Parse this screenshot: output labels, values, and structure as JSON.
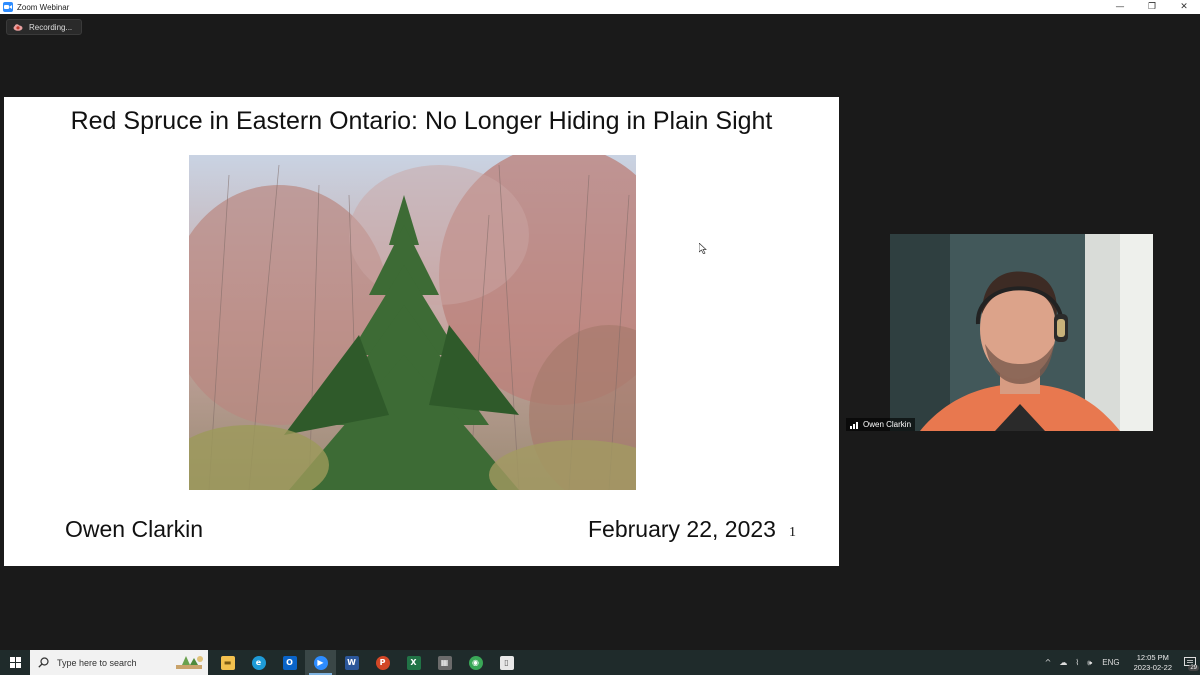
{
  "window": {
    "title": "Zoom Webinar",
    "controls": {
      "minimize": "—",
      "restore": "❐",
      "close": "✕"
    }
  },
  "recording": {
    "label": "Recording..."
  },
  "slide": {
    "title": "Red Spruce in Eastern Ontario: No Longer Hiding in Plain Sight",
    "author": "Owen Clarkin",
    "date": "February 22, 2023",
    "page_number": "1",
    "photo_icon": "red-spruce-photo"
  },
  "video": {
    "participant_name": "Owen Clarkin",
    "signal_icon": "signal-bars-icon"
  },
  "taskbar": {
    "search_placeholder": "Type here to search",
    "apps": [
      {
        "name": "file-explorer",
        "color": "#f2c14e",
        "glyph": "▬"
      },
      {
        "name": "edge",
        "color": "#1e9bd7",
        "glyph": "e"
      },
      {
        "name": "outlook",
        "color": "#0a64c8",
        "glyph": "O"
      },
      {
        "name": "zoom",
        "color": "#2d8cff",
        "glyph": "▶"
      },
      {
        "name": "word",
        "color": "#2b579a",
        "glyph": "W"
      },
      {
        "name": "powerpoint",
        "color": "#d24726",
        "glyph": "P"
      },
      {
        "name": "excel",
        "color": "#217346",
        "glyph": "X"
      },
      {
        "name": "calculator",
        "color": "#6b6b6b",
        "glyph": "▦"
      },
      {
        "name": "maps",
        "color": "#3aa757",
        "glyph": "◉"
      },
      {
        "name": "notepad",
        "color": "#e8e8e8",
        "glyph": "▯"
      }
    ],
    "tray": {
      "chevron": "^",
      "cloud": "☁",
      "network": "⌇",
      "volume": "🕪",
      "language": "ENG",
      "time": "12:05 PM",
      "date": "2023-02-22",
      "notifications": "29"
    }
  },
  "colors": {
    "background": "#1a1a1a",
    "taskbar": "#1f2b2b",
    "zoom_blue": "#2d8cff",
    "slide_bg": "#ffffff"
  }
}
